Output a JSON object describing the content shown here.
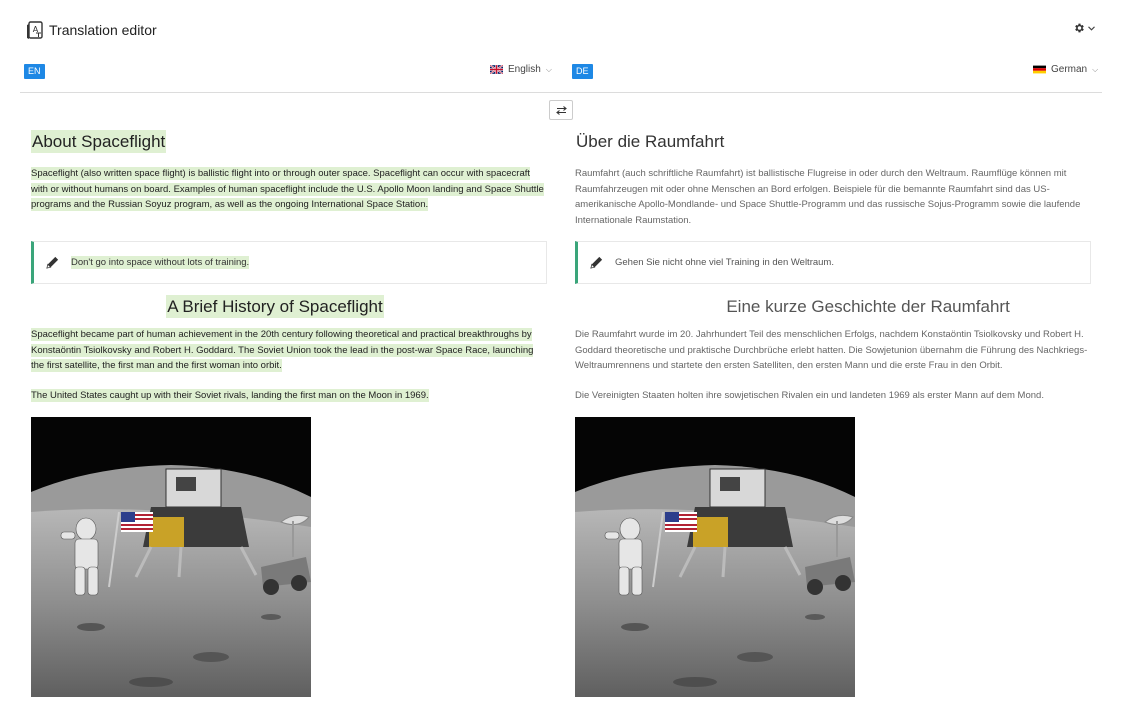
{
  "app": {
    "title": "Translation editor",
    "logo_icon": "translate-book-icon",
    "settings_icon": "gear-icon"
  },
  "source": {
    "badge": "EN",
    "language_label": "English",
    "title": "About Spaceflight",
    "intro": "Spaceflight (also written space flight) is ballistic flight into or through outer space. Spaceflight can occur with spacecraft with or without humans on board. Examples of human spaceflight include the U.S. Apollo Moon landing and Space Shuttle programs and the Russian Soyuz program, as well as the ongoing International Space Station.",
    "note": "Don't go into space without lots of training.",
    "history_title": "A Brief History of Spaceflight",
    "history_p1": "Spaceflight became part of human achievement in the 20th century following theoretical and practical breakthroughs by Konstaöntin Tsiolkovsky and Robert H. Goddard. The Soviet Union took the lead in the post-war Space Race, launching the first satellite, the first man and the first woman into orbit.",
    "history_p2": "The United States caught up with their Soviet rivals, landing the first man on the Moon in 1969."
  },
  "target": {
    "badge": "DE",
    "language_label": "German",
    "title": "Über die Raumfahrt",
    "intro": "Raumfahrt (auch schriftliche Raumfahrt) ist ballistische Flugreise in oder durch den Weltraum. Raumflüge können mit Raumfahrzeugen mit oder ohne Menschen an Bord erfolgen. Beispiele für die bemannte Raumfahrt sind das US-amerikanische Apollo-Mondlande- und Space Shuttle-Programm und das russische Sojus-Programm sowie die laufende Internationale Raumstation.",
    "note": "Gehen Sie nicht ohne viel Training in den Weltraum.",
    "history_title": "Eine kurze Geschichte der Raumfahrt",
    "history_p1": "Die Raumfahrt wurde im 20. Jahrhundert Teil des menschlichen Erfolgs, nachdem Konstaöntin Tsiolkovsky und Robert H. Goddard theoretische und praktische Durchbrüche erlebt hatten. Die Sowjetunion übernahm die Führung des Nachkriegs-Weltraumrennens und startete den ersten Satelliten, den ersten Mann und die erste Frau in den Orbit.",
    "history_p2": "Die Vereinigten Staaten holten ihre sowjetischen Rivalen ein und landeten 1969 als erster Mann auf dem Mond."
  },
  "toolbar": {
    "swap_icon": "swap-arrows-icon"
  },
  "colors": {
    "badge": "#1e88e5",
    "highlight": "#dff0d2",
    "note_accent": "#3aa57a",
    "divider": "#dcdcdc"
  }
}
